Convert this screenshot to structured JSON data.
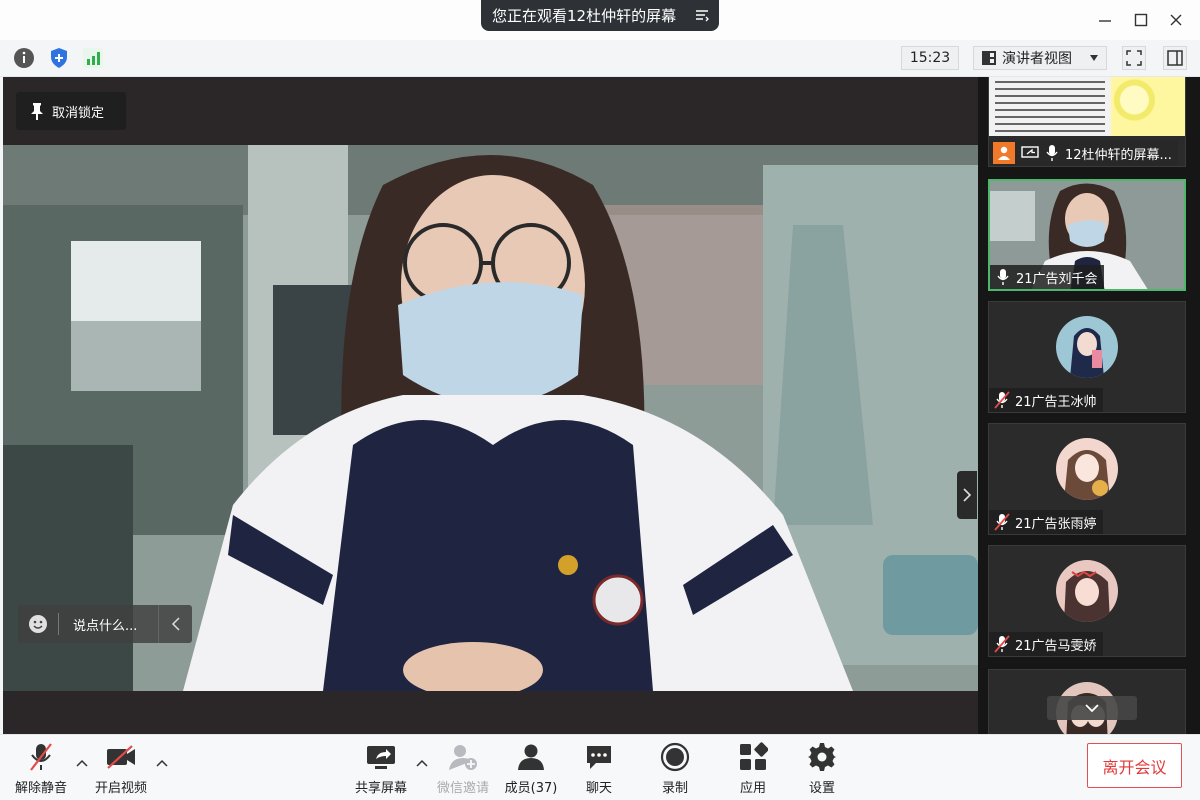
{
  "window": {
    "share_banner": "您正在观看12杜仲轩的屏幕"
  },
  "toolbar": {
    "time": "15:23",
    "view_mode": "演讲者视图"
  },
  "main": {
    "unpin_label": "取消锁定",
    "chat_placeholder": "说点什么..."
  },
  "sidebar": {
    "tiles": [
      {
        "name": "12杜仲轩的屏幕...",
        "mic": "on"
      },
      {
        "name": "21广告刘千会",
        "mic": "on"
      },
      {
        "name": "21广告王冰帅",
        "mic": "muted"
      },
      {
        "name": "21广告张雨婷",
        "mic": "muted"
      },
      {
        "name": "21广告马雯娇",
        "mic": "muted"
      }
    ]
  },
  "bottombar": {
    "unmute": "解除静音",
    "start_video": "开启视频",
    "share_screen": "共享屏幕",
    "wechat_invite": "微信邀请",
    "members": "成员(37)",
    "chat": "聊天",
    "record": "录制",
    "apps": "应用",
    "settings": "设置",
    "leave": "离开会议"
  },
  "colors": {
    "accent_green": "#4db86a",
    "leave_red": "#e03a3a",
    "banner_bg": "#2e3135"
  }
}
